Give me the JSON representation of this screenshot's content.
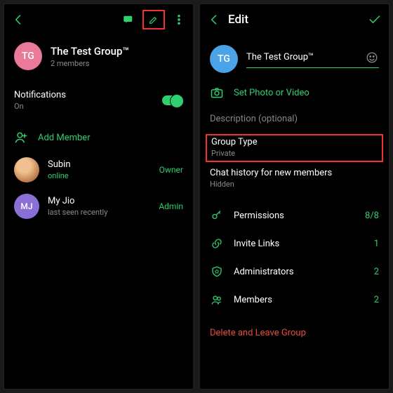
{
  "colors": {
    "accent": "#2ecf6f",
    "pink": "#e97a9a",
    "blue": "#4aa3e6",
    "purple": "#8a6fd6",
    "orange": "#d68a4a"
  },
  "left": {
    "group": {
      "initials": "TG",
      "name": "The Test Group™",
      "members": "2 members"
    },
    "notifications": {
      "label": "Notifications",
      "state": "On"
    },
    "add_member": "Add Member",
    "members": [
      {
        "initials": "",
        "name": "Subin",
        "status": "online",
        "role": "Owner",
        "color": "#d68a4a",
        "photo": true
      },
      {
        "initials": "MJ",
        "name": "My Jio",
        "status": "last seen recently",
        "role": "Admin",
        "color": "#8a6fd6",
        "photo": false
      }
    ]
  },
  "right": {
    "title": "Edit",
    "group": {
      "initials": "TG",
      "name": "The Test Group™"
    },
    "set_photo": "Set Photo or Video",
    "description": "Description (optional)",
    "group_type": {
      "label": "Group Type",
      "value": "Private"
    },
    "chat_history": {
      "label": "Chat history for new members",
      "value": "Hidden"
    },
    "actions": [
      {
        "key": "permissions",
        "label": "Permissions",
        "value": "8/8"
      },
      {
        "key": "invite",
        "label": "Invite Links",
        "value": "1"
      },
      {
        "key": "admins",
        "label": "Administrators",
        "value": "2"
      },
      {
        "key": "members",
        "label": "Members",
        "value": "2"
      }
    ],
    "delete": "Delete and Leave Group"
  }
}
